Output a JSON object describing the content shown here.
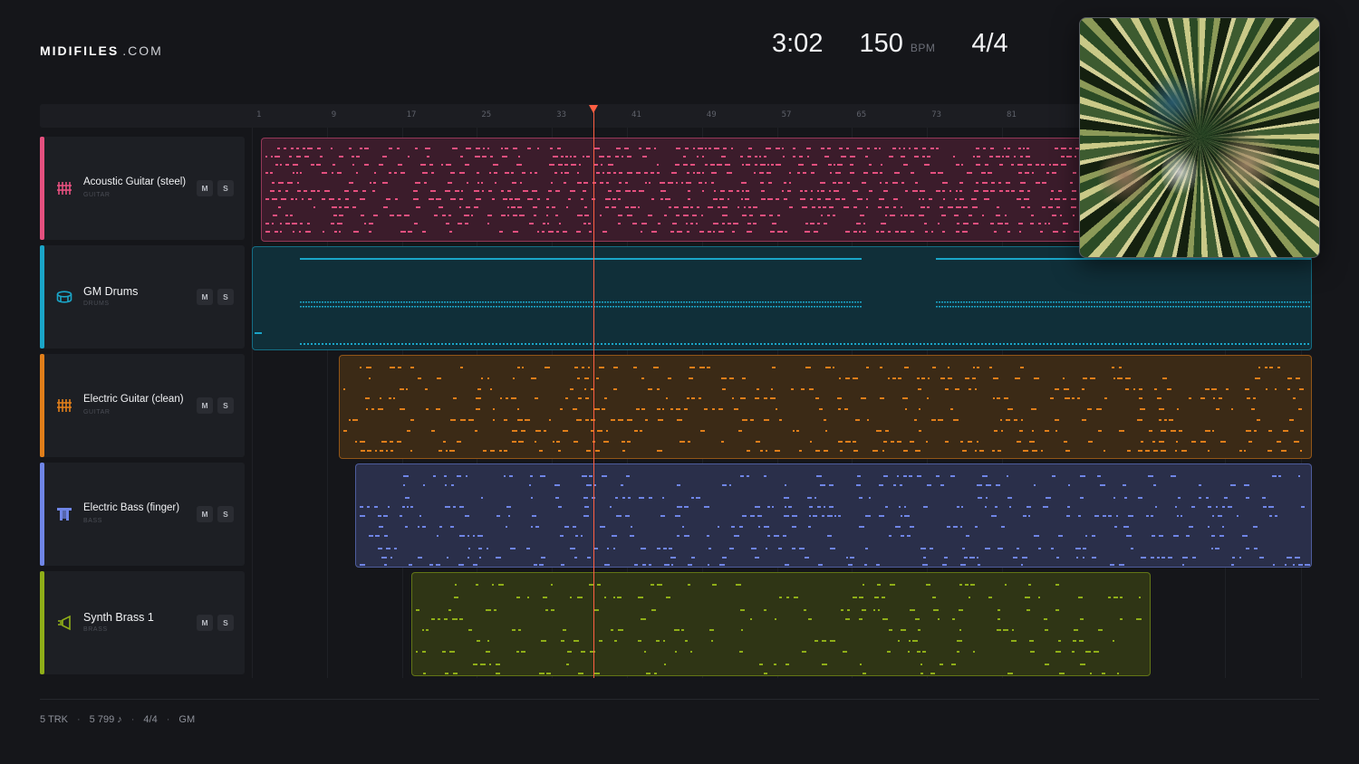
{
  "brand": {
    "name_bold": "MIDIFILES",
    "name_light": ".COM"
  },
  "stats": {
    "duration": "3:02",
    "bpm": "150",
    "bpm_unit": "BPM",
    "meter": "4/4"
  },
  "ruler": {
    "marks": [
      "1",
      "9",
      "17",
      "25",
      "33",
      "41",
      "49",
      "57",
      "65",
      "73",
      "81"
    ]
  },
  "playhead": {
    "bar": 36
  },
  "tracks": [
    {
      "name": "Acoustic Guitar (steel)",
      "category": "GUITAR",
      "color": "#e5507f",
      "clip_fill": "#3b1c2b",
      "icon": "guitar-fretboard-icon",
      "mute": "M",
      "solo": "S"
    },
    {
      "name": "GM Drums",
      "category": "DRUMS",
      "color": "#1aa5c8",
      "clip_fill": "#102f39",
      "icon": "drum-icon",
      "mute": "M",
      "solo": "S"
    },
    {
      "name": "Electric Guitar (clean)",
      "category": "GUITAR",
      "color": "#e07e1a",
      "clip_fill": "#3b2a16",
      "icon": "guitar-fretboard-icon",
      "mute": "M",
      "solo": "S"
    },
    {
      "name": "Electric Bass (finger)",
      "category": "BASS",
      "color": "#6f85e6",
      "clip_fill": "#2a2f4a",
      "icon": "bass-icon",
      "mute": "M",
      "solo": "S"
    },
    {
      "name": "Synth Brass 1",
      "category": "BRASS",
      "color": "#8fae18",
      "clip_fill": "#2f3515",
      "icon": "brass-horn-icon",
      "mute": "M",
      "solo": "S"
    }
  ],
  "footer": {
    "tracks": "5 TRK",
    "notes": "5 799 ♪",
    "meter": "4/4",
    "standard": "GM",
    "separator": "·"
  },
  "cover": {
    "alt": "album-cover"
  }
}
